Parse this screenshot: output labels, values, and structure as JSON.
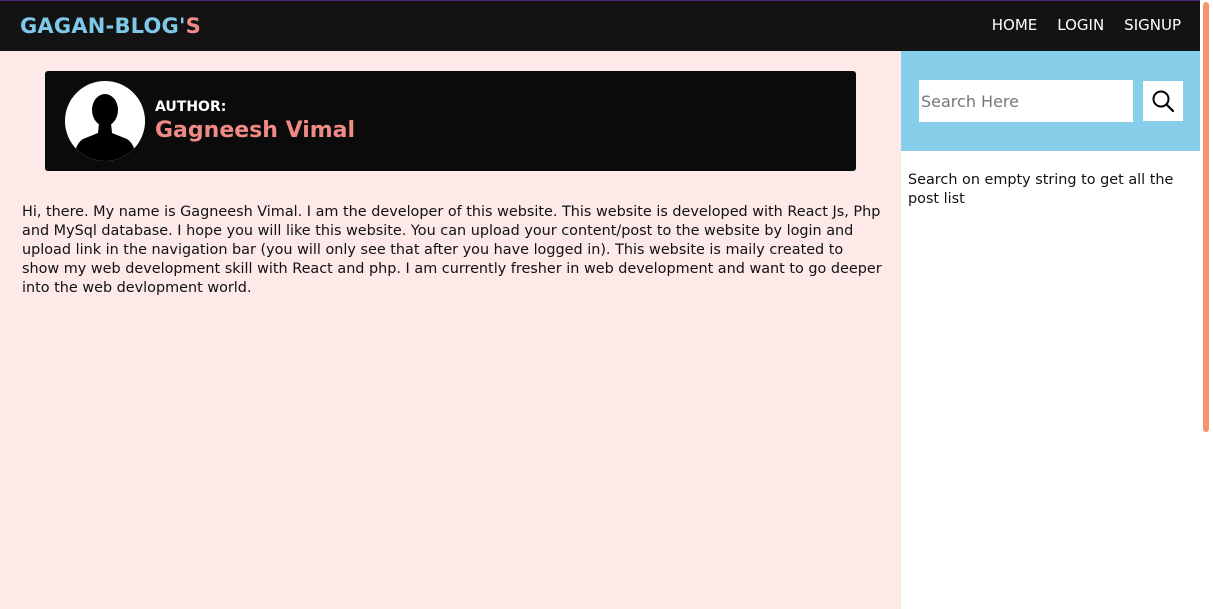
{
  "navbar": {
    "brand_main": "GAGAN-BLOG'",
    "brand_accent": "S",
    "links": [
      "HOME",
      "LOGIN",
      "SIGNUP"
    ]
  },
  "author": {
    "label": "AUTHOR:",
    "name": "Gagneesh Vimal",
    "avatar_icon": "user-silhouette-icon"
  },
  "about": {
    "text": "Hi, there. My name is Gagneesh Vimal. I am the developer of this website. This website is developed with React Js, Php and MySql database. I hope you will like this website. You can upload your content/post to the website by login and upload link in the navigation bar (you will only see that after you have logged in). This website is maily created to show my web development skill with React and php. I am currently fresher in web development and want to go deeper into the web devlopment world."
  },
  "sidebar": {
    "search_placeholder": "Search Here",
    "search_icon": "search-icon",
    "hint": "Search on empty string to get all the post list"
  },
  "colors": {
    "navbar_bg": "#131313",
    "brand_blue": "#7ec8ea",
    "accent_salmon": "#f08a84",
    "page_bg": "#fce9e8",
    "search_panel_bg": "#87ceeb",
    "scrollbar": "#f4956d"
  }
}
